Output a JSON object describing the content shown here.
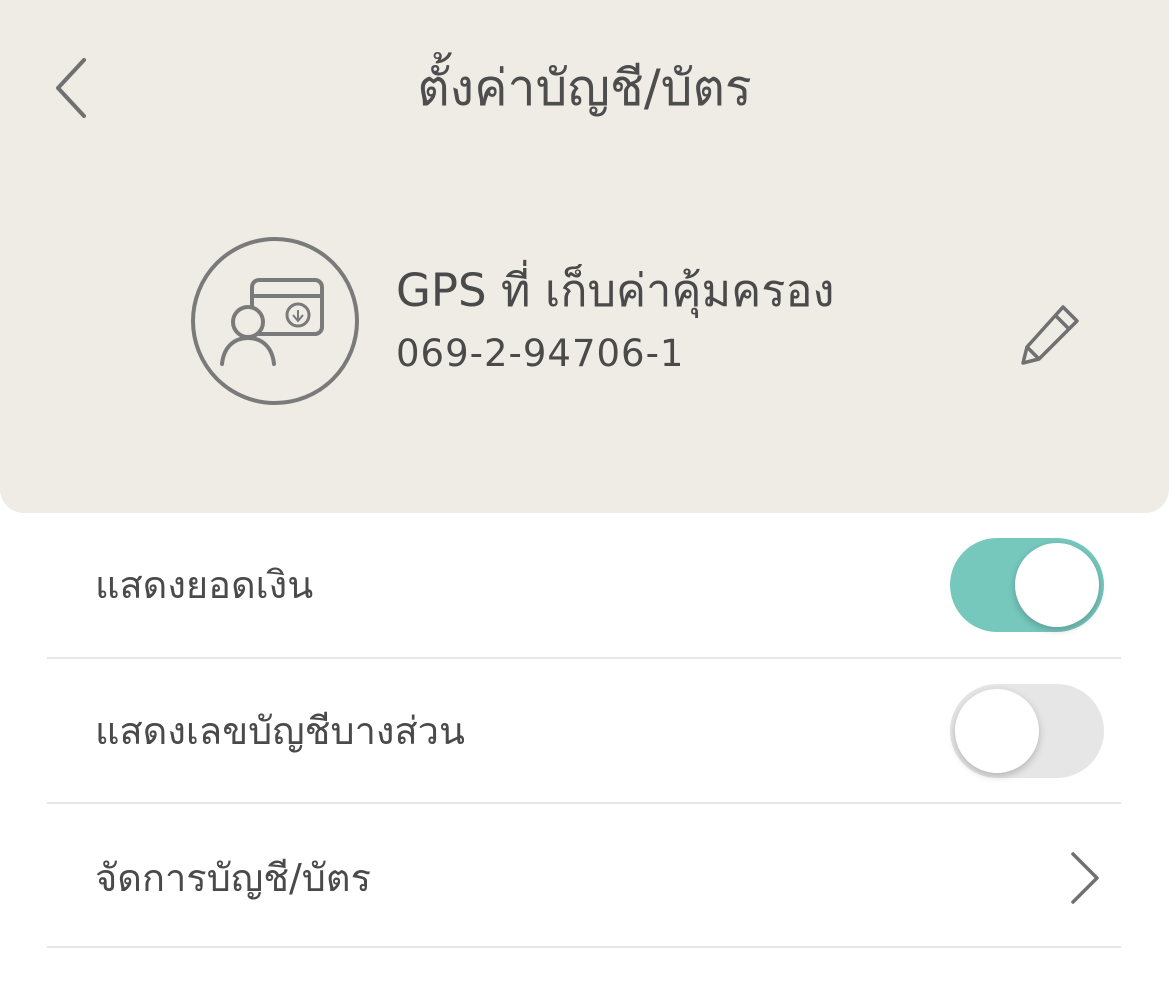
{
  "header": {
    "title": "ตั้งค่าบัญชี/บัตร",
    "back_icon": "chevron-left-icon"
  },
  "account": {
    "icon": "account-card-icon",
    "name": "GPS ที่ เก็บค่าคุ้มครอง",
    "number": "069-2-94706-1",
    "edit_icon": "pencil-icon"
  },
  "settings": [
    {
      "label": "แสดงยอดเงิน",
      "control": "toggle",
      "on": true
    },
    {
      "label": "แสดงเลขบัญชีบางส่วน",
      "control": "toggle",
      "on": false
    },
    {
      "label": "จัดการบัญชี/บัตร",
      "control": "chevron-right-icon"
    }
  ],
  "colors": {
    "header_background": "#efebe5",
    "toggle_on": "#76c8bd",
    "toggle_off": "#e6e6e6",
    "text": "#4a4a4a"
  }
}
